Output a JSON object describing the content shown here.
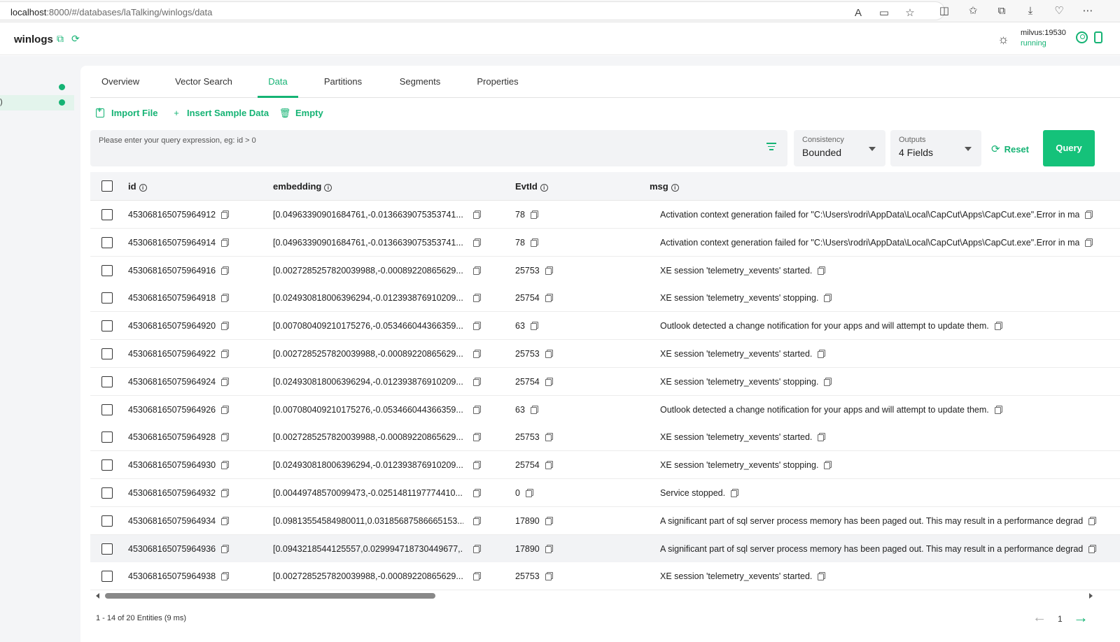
{
  "browser": {
    "url_host": "localhost",
    "url_path": ":8000/#/databases/laTalking/winlogs/data",
    "icons": [
      "read-aloud-icon",
      "reader-view-icon",
      "favorite-star-icon",
      "split-screen-icon",
      "favorites-icon",
      "collections-icon",
      "downloads-icon",
      "extensions-icon",
      "more-icon"
    ]
  },
  "header": {
    "title": "winlogs",
    "server_name": "milvus:19530",
    "server_status": "running"
  },
  "sidebar": {
    "items": [
      {
        "label": "",
        "active": false
      },
      {
        "label": ")",
        "active": true
      }
    ]
  },
  "tabs": [
    {
      "label": "Overview",
      "active": false
    },
    {
      "label": "Vector Search",
      "active": false
    },
    {
      "label": "Data",
      "active": true
    },
    {
      "label": "Partitions",
      "active": false
    },
    {
      "label": "Segments",
      "active": false
    },
    {
      "label": "Properties",
      "active": false
    }
  ],
  "toolbar": {
    "import_label": "Import File",
    "insert_label": "Insert Sample Data",
    "empty_label": "Empty"
  },
  "query": {
    "placeholder": "Please enter your query expression, eg: id > 0",
    "consistency_label": "Consistency",
    "consistency_value": "Bounded",
    "outputs_label": "Outputs",
    "outputs_value": "4 Fields",
    "reset_label": "Reset",
    "query_label": "Query"
  },
  "table": {
    "columns": [
      "id",
      "embedding",
      "EvtId",
      "msg"
    ],
    "rows": [
      {
        "id": "453068165075964912",
        "embedding": "[0.04963390901684761,-0.0136639075353741...",
        "evtid": "78",
        "msg": "Activation context generation failed for \"C:\\Users\\rodri\\AppData\\Local\\CapCut\\Apps\\CapCut.exe\".Error in ma"
      },
      {
        "id": "453068165075964914",
        "embedding": "[0.04963390901684761,-0.0136639075353741...",
        "evtid": "78",
        "msg": "Activation context generation failed for \"C:\\Users\\rodri\\AppData\\Local\\CapCut\\Apps\\CapCut.exe\".Error in ma"
      },
      {
        "id": "453068165075964916",
        "embedding": "[0.0027285257820039988,-0.00089220865629...",
        "evtid": "25753",
        "msg": "XE session 'telemetry_xevents' started."
      },
      {
        "id": "453068165075964918",
        "embedding": "[0.024930818006396294,-0.012393876910209...",
        "evtid": "25754",
        "msg": "XE session 'telemetry_xevents' stopping."
      },
      {
        "id": "453068165075964920",
        "embedding": "[0.007080409210175276,-0.053466044366359...",
        "evtid": "63",
        "msg": "Outlook detected a change notification for your apps and will attempt to update them."
      },
      {
        "id": "453068165075964922",
        "embedding": "[0.0027285257820039988,-0.00089220865629...",
        "evtid": "25753",
        "msg": "XE session 'telemetry_xevents' started."
      },
      {
        "id": "453068165075964924",
        "embedding": "[0.024930818006396294,-0.012393876910209...",
        "evtid": "25754",
        "msg": "XE session 'telemetry_xevents' stopping."
      },
      {
        "id": "453068165075964926",
        "embedding": "[0.007080409210175276,-0.053466044366359...",
        "evtid": "63",
        "msg": "Outlook detected a change notification for your apps and will attempt to update them."
      },
      {
        "id": "453068165075964928",
        "embedding": "[0.0027285257820039988,-0.00089220865629...",
        "evtid": "25753",
        "msg": "XE session 'telemetry_xevents' started."
      },
      {
        "id": "453068165075964930",
        "embedding": "[0.024930818006396294,-0.012393876910209...",
        "evtid": "25754",
        "msg": "XE session 'telemetry_xevents' stopping."
      },
      {
        "id": "453068165075964932",
        "embedding": "[0.00449748570099473,-0.0251481197774410...",
        "evtid": "0",
        "msg": "Service stopped."
      },
      {
        "id": "453068165075964934",
        "embedding": "[0.09813554584980011,0.03185687586665153...",
        "evtid": "17890",
        "msg": "A significant part of sql server process memory has been paged out. This may result in a performance degrad"
      },
      {
        "id": "453068165075964936",
        "embedding": "[0.0943218544125557,0.029994718730449677,...",
        "evtid": "17890",
        "msg": "A significant part of sql server process memory has been paged out. This may result in a performance degrad",
        "highlighted": true
      },
      {
        "id": "453068165075964938",
        "embedding": "[0.0027285257820039988,-0.00089220865629...",
        "evtid": "25753",
        "msg": "XE session 'telemetry_xevents' started."
      }
    ]
  },
  "footer": {
    "count_text": "1 - 14  of 20 Entities (9 ms)",
    "page": "1"
  }
}
